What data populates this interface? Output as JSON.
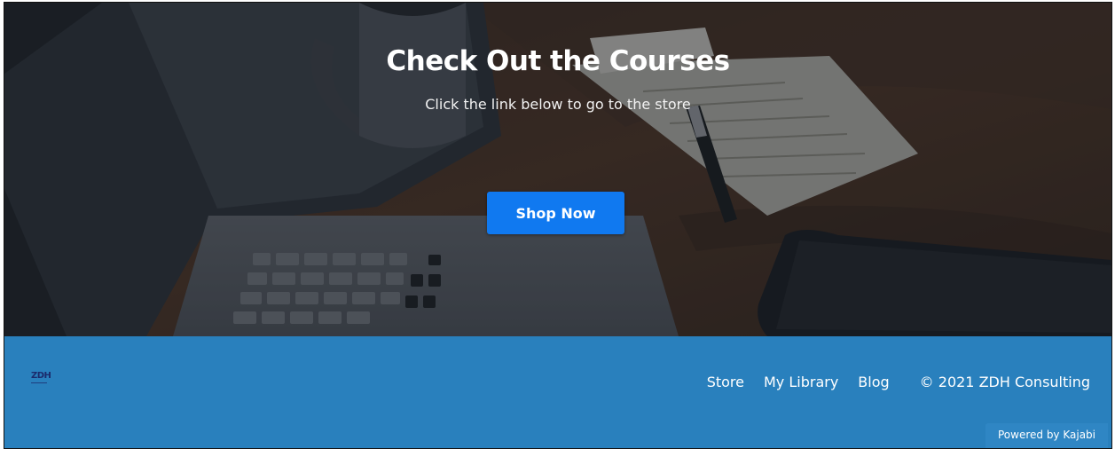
{
  "hero": {
    "title": "Check Out the Courses",
    "subtitle": "Click the link below to go to the store",
    "button_label": "Shop Now",
    "button_color": "#1079f0"
  },
  "footer": {
    "logo_text": "ZDH",
    "nav": {
      "store": "Store",
      "library": "My Library",
      "blog": "Blog"
    },
    "copyright": "© 2021 ZDH Consulting",
    "powered_by": "Powered by Kajabi",
    "background_color": "#2980bd"
  }
}
